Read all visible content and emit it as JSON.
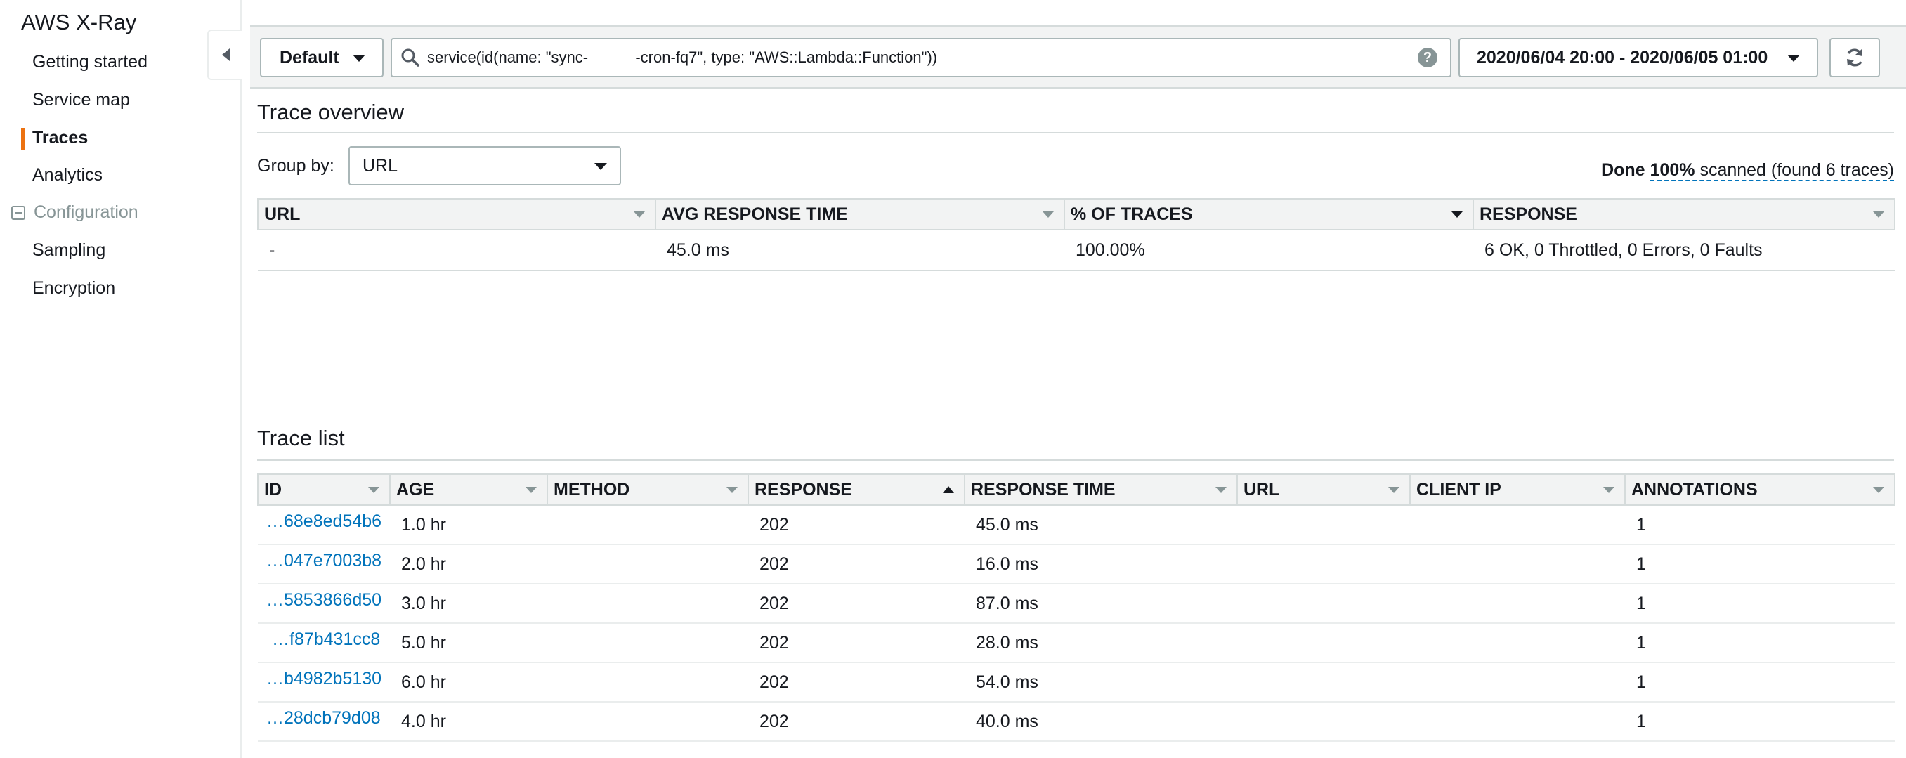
{
  "sidebar": {
    "app_title": "AWS X-Ray",
    "items": [
      {
        "label": "Getting started"
      },
      {
        "label": "Service map"
      },
      {
        "label": "Traces"
      },
      {
        "label": "Analytics"
      }
    ],
    "config_group": "Configuration",
    "config_items": [
      {
        "label": "Sampling"
      },
      {
        "label": "Encryption"
      }
    ]
  },
  "toolbar": {
    "group_label": "Default",
    "search_value": "service(id(name: \"sync-           -cron-fq7\", type: \"AWS::Lambda::Function\"))",
    "help_glyph": "?",
    "time_range": "2020/06/04 20:00 - 2020/06/05 01:00",
    "refresh_icon": "refresh-icon"
  },
  "overview": {
    "title": "Trace overview",
    "group_by_label": "Group by:",
    "group_by_value": "URL",
    "status_done": "Done",
    "status_pct": "100%",
    "status_rest": "scanned (found 6 traces)",
    "columns": [
      "URL",
      "AVG RESPONSE TIME",
      "% OF TRACES",
      "RESPONSE"
    ],
    "rows": [
      [
        "-",
        "45.0 ms",
        "100.00%",
        "6 OK, 0 Throttled, 0 Errors, 0 Faults"
      ]
    ]
  },
  "trace_list": {
    "title": "Trace list",
    "columns": [
      "ID",
      "AGE",
      "METHOD",
      "RESPONSE",
      "RESPONSE TIME",
      "URL",
      "CLIENT IP",
      "ANNOTATIONS"
    ],
    "rows": [
      {
        "id": "…68e8ed54b6",
        "age": "1.0 hr",
        "method": "",
        "response": "202",
        "response_time": "45.0 ms",
        "url": "",
        "client_ip": "",
        "annotations": "1"
      },
      {
        "id": "…047e7003b8",
        "age": "2.0 hr",
        "method": "",
        "response": "202",
        "response_time": "16.0 ms",
        "url": "",
        "client_ip": "",
        "annotations": "1"
      },
      {
        "id": "…5853866d50",
        "age": "3.0 hr",
        "method": "",
        "response": "202",
        "response_time": "87.0 ms",
        "url": "",
        "client_ip": "",
        "annotations": "1"
      },
      {
        "id": "…f87b431cc8",
        "age": "5.0 hr",
        "method": "",
        "response": "202",
        "response_time": "28.0 ms",
        "url": "",
        "client_ip": "",
        "annotations": "1"
      },
      {
        "id": "…b4982b5130",
        "age": "6.0 hr",
        "method": "",
        "response": "202",
        "response_time": "54.0 ms",
        "url": "",
        "client_ip": "",
        "annotations": "1"
      },
      {
        "id": "…28dcb79d08",
        "age": "4.0 hr",
        "method": "",
        "response": "202",
        "response_time": "40.0 ms",
        "url": "",
        "client_ip": "",
        "annotations": "1"
      }
    ]
  },
  "colors": {
    "accent": "#ec7211",
    "link": "#0073bb",
    "header_bg": "#f2f3f3"
  }
}
